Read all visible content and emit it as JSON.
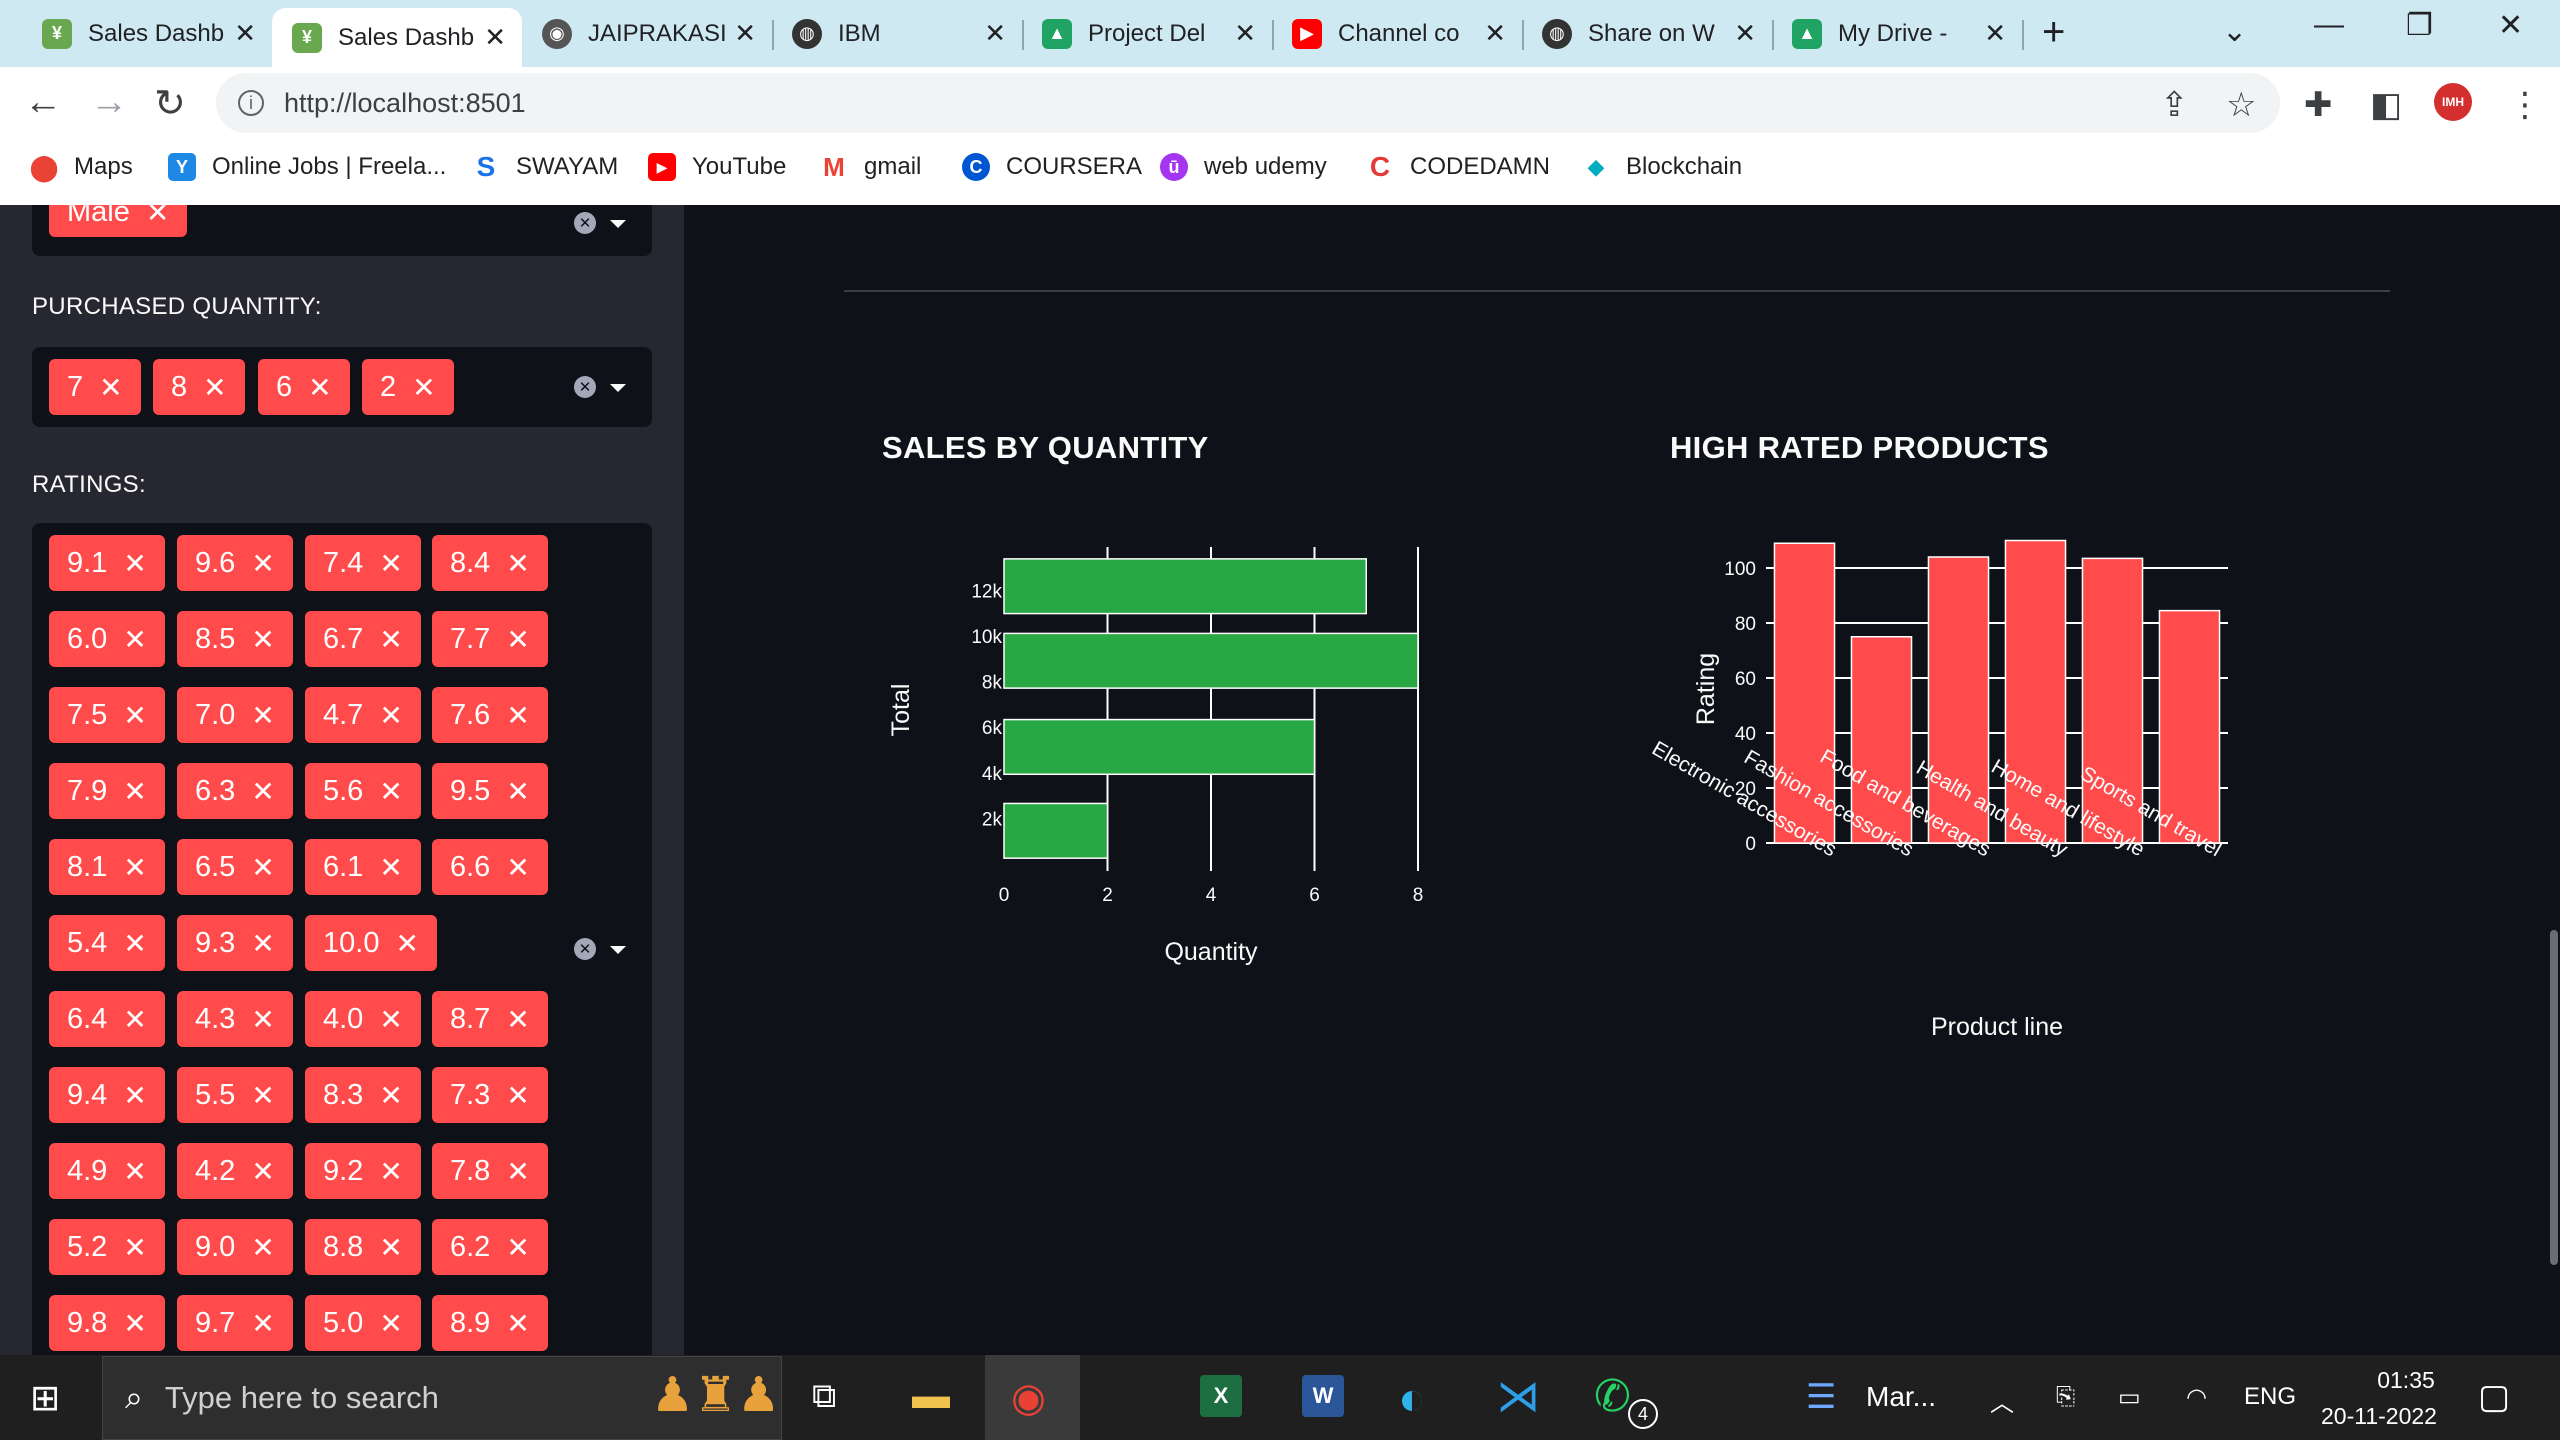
{
  "browser": {
    "tabs": [
      {
        "title": "Sales Dashb",
        "favicon_color": "#6aa84f",
        "active": false
      },
      {
        "title": "Sales Dashb",
        "favicon_color": "#6aa84f",
        "active": true
      },
      {
        "title": "JAIPRAKASI",
        "favicon_color": "#555555",
        "active": false
      },
      {
        "title": "IBM",
        "favicon_color": "#333333",
        "active": false
      },
      {
        "title": "Project Del",
        "favicon_color": "#1fa463",
        "active": false
      },
      {
        "title": "Channel co",
        "favicon_color": "#ff0000",
        "active": false
      },
      {
        "title": "Share on W",
        "favicon_color": "#333333",
        "active": false
      },
      {
        "title": "My Drive -",
        "favicon_color": "#1fa463",
        "active": false
      }
    ],
    "url": "http://localhost:8501",
    "profile_label": "IMH",
    "bookmarks": [
      {
        "label": "Maps",
        "color": "#34a853"
      },
      {
        "label": "Online Jobs | Freela...",
        "color": "#1e88e5"
      },
      {
        "label": "SWAYAM",
        "color": "#1a73e8"
      },
      {
        "label": "YouTube",
        "color": "#ff0000"
      },
      {
        "label": "gmail",
        "color": "#ea4335"
      },
      {
        "label": "COURSERA",
        "color": "#0056d2"
      },
      {
        "label": "web udemy",
        "color": "#a435f0"
      },
      {
        "label": "CODEDAMN",
        "color": "#e53935"
      },
      {
        "label": "Blockchain",
        "color": "#00acc1"
      }
    ]
  },
  "sidebar": {
    "gender_chip": "Male",
    "quantity_label": "PURCHASED QUANTITY:",
    "quantity_chips": [
      "7",
      "8",
      "6",
      "2"
    ],
    "ratings_label": "RATINGS:",
    "ratings_chips": [
      [
        "9.1",
        "9.6",
        "7.4",
        "8.4"
      ],
      [
        "6.0",
        "8.5",
        "6.7",
        "7.7"
      ],
      [
        "7.5",
        "7.0",
        "4.7",
        "7.6"
      ],
      [
        "7.9",
        "6.3",
        "5.6",
        "9.5"
      ],
      [
        "8.1",
        "6.5",
        "6.1",
        "6.6"
      ],
      [
        "5.4",
        "9.3",
        "10.0"
      ],
      [
        "6.4",
        "4.3",
        "4.0",
        "8.7"
      ],
      [
        "9.4",
        "5.5",
        "8.3",
        "7.3"
      ],
      [
        "4.9",
        "4.2",
        "9.2",
        "7.8"
      ],
      [
        "5.2",
        "9.0",
        "8.8",
        "6.2"
      ],
      [
        "9.8",
        "9.7",
        "5.0",
        "8.9"
      ]
    ]
  },
  "chart_data": [
    {
      "type": "bar",
      "orientation": "horizontal",
      "title": "SALES BY QUANTITY",
      "xlabel": "Quantity",
      "ylabel": "Total",
      "xlim": [
        0,
        8
      ],
      "x_ticks": [
        "0",
        "2",
        "4",
        "6",
        "8"
      ],
      "ylim": [
        0,
        13600
      ],
      "y_ticks": [
        2000,
        4000,
        6000,
        8000,
        10000,
        12000
      ],
      "y_tick_labels": [
        "2k",
        "4k",
        "6k",
        "8k",
        "10k",
        "12k"
      ],
      "bar_color": "#28a745",
      "bars": [
        {
          "y": 12230,
          "value": 7
        },
        {
          "y": 8960,
          "value": 8
        },
        {
          "y": 5180,
          "value": 6
        },
        {
          "y": 1500,
          "value": 2
        }
      ],
      "bar_height": 2400
    },
    {
      "type": "bar",
      "title": "HIGH RATED PRODUCTS",
      "xlabel": "Product line",
      "ylabel": "Rating",
      "ylim": [
        0,
        112
      ],
      "y_ticks": [
        "0",
        "20",
        "40",
        "60",
        "80",
        "100"
      ],
      "bar_color": "#ff4b4b",
      "categories": [
        "Electronic accessories",
        "Fashion accessories",
        "Food and beverages",
        "Health and beauty",
        "Home and lifestyle",
        "Sports and travel"
      ],
      "values": [
        109,
        75,
        104,
        110,
        103.5,
        84.5
      ]
    }
  ],
  "taskbar": {
    "search_placeholder": "Type here to search",
    "active_app_label": "Mar...",
    "language": "ENG",
    "time": "01:35",
    "date": "20-11-2022",
    "whatsapp_badge": "4"
  }
}
